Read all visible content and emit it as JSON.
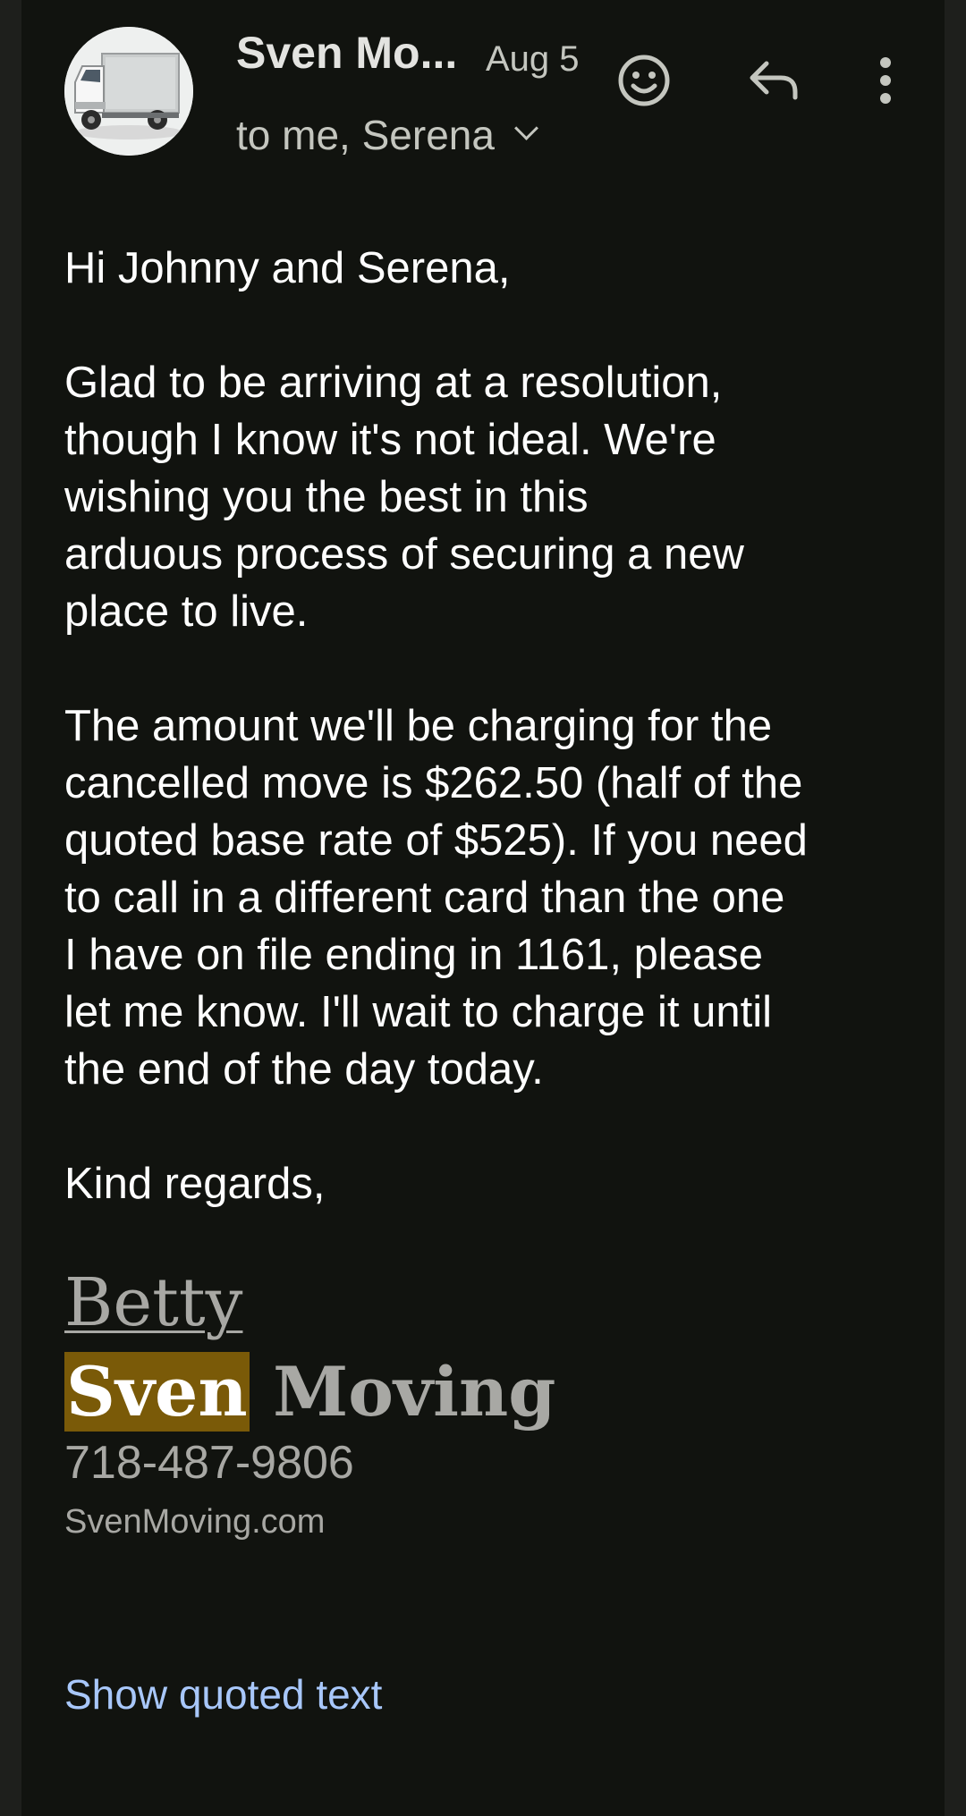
{
  "header": {
    "sender_name": "Sven Mo...",
    "date": "Aug 5",
    "recipients": "to me, Serena",
    "avatar_icon": "moving-truck-avatar",
    "actions": {
      "emoji_icon": "smiley-icon",
      "reply_icon": "reply-icon",
      "more_icon": "more-vert-icon"
    }
  },
  "body": {
    "greeting": "Hi Johnny and Serena,",
    "paragraph1": [
      "Glad to be arriving at a resolution,",
      "though I know it's not ideal. We're",
      "wishing you the best in this",
      "arduous process of securing a new",
      "place to live."
    ],
    "paragraph2": [
      "The amount we'll be charging for the",
      "cancelled move is $262.50 (half of the",
      "quoted base rate of $525). If you need",
      "to call in a different card than the one",
      "I have on file ending in 1161, please",
      "let me know. I'll wait to charge it until",
      "the end of the day today."
    ],
    "closing": "Kind regards,"
  },
  "signature": {
    "name": "Betty",
    "company_highlight": "Sven",
    "company_rest": " Moving",
    "phone": "718-487-9806",
    "website": "SvenMoving.com"
  },
  "footer": {
    "show_quoted_label": "Show quoted text"
  },
  "colors": {
    "background": "#11130f",
    "text": "#ffffff",
    "muted": "#c4c6bf",
    "signature": "#a8a8a4",
    "highlight": "#7a5a08",
    "link": "#a8c7fa"
  }
}
